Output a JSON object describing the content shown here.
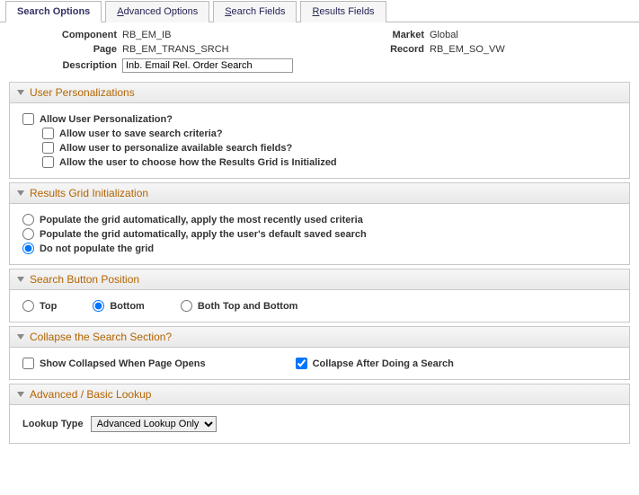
{
  "tabs": {
    "search_options": "Search Options",
    "advanced_options": "Advanced Options",
    "search_fields": "Search Fields",
    "results_fields": "Results Fields",
    "underline_chars": {
      "advanced": "A",
      "search": "S",
      "results": "R"
    }
  },
  "header": {
    "component_label": "Component",
    "component": "RB_EM_IB",
    "page_label": "Page",
    "page": "RB_EM_TRANS_SRCH",
    "description_label": "Description",
    "description": "Inb. Email Rel. Order Search",
    "market_label": "Market",
    "market": "Global",
    "record_label": "Record",
    "record": "RB_EM_SO_VW"
  },
  "sections": {
    "user_personalizations": {
      "title": "User Personalizations",
      "allow": {
        "label": "Allow User Personalization?",
        "checked": false
      },
      "save_criteria": {
        "label": "Allow user to save search criteria?",
        "checked": false
      },
      "personalize_fields": {
        "label": "Allow user to personalize available search fields?",
        "checked": false
      },
      "choose_init": {
        "label": "Allow the user to choose how the Results Grid is Initialized",
        "checked": false
      }
    },
    "results_grid": {
      "title": "Results Grid Initialization",
      "opt1": "Populate the grid automatically, apply the most recently used criteria",
      "opt2": "Populate the grid automatically, apply the user's default saved search",
      "opt3": "Do not populate the grid",
      "selected": "opt3"
    },
    "button_position": {
      "title": "Search Button Position",
      "top": "Top",
      "bottom": "Bottom",
      "both": "Both Top and Bottom",
      "selected": "bottom"
    },
    "collapse": {
      "title": "Collapse the Search Section?",
      "show_collapsed": {
        "label": "Show Collapsed When Page Opens",
        "checked": false
      },
      "after_search": {
        "label": "Collapse After Doing a Search",
        "checked": true
      }
    },
    "lookup": {
      "title": "Advanced / Basic Lookup",
      "label": "Lookup Type",
      "selected": "Advanced Lookup Only"
    }
  }
}
